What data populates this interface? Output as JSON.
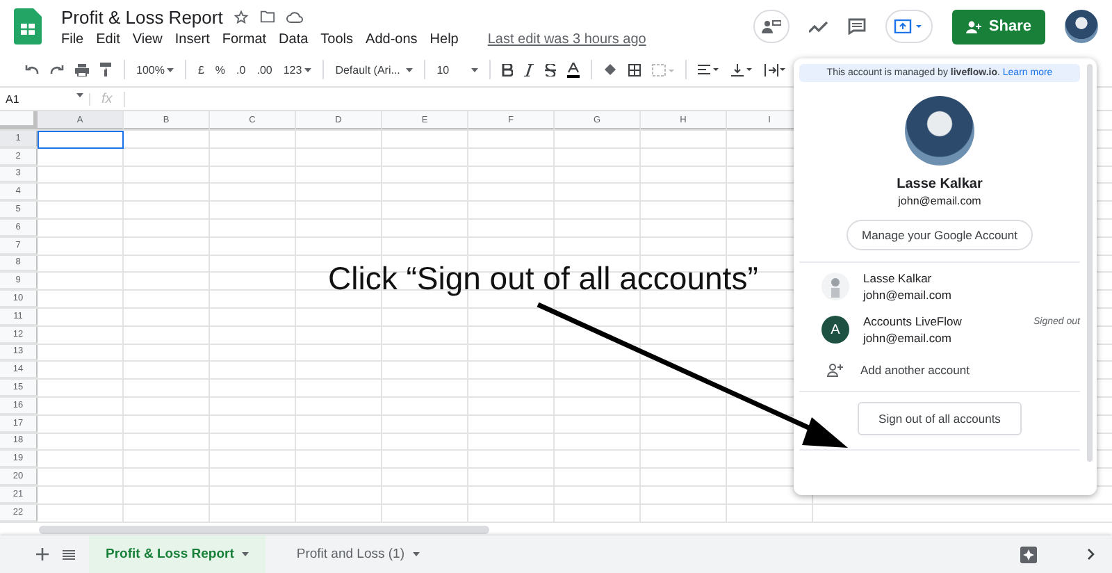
{
  "header": {
    "title": "Profit & Loss Report",
    "menu": [
      "File",
      "Edit",
      "View",
      "Insert",
      "Format",
      "Data",
      "Tools",
      "Add-ons",
      "Help"
    ],
    "last_edit": "Last edit was 3 hours ago",
    "share": "Share"
  },
  "toolbar": {
    "zoom": "100%",
    "currency": "£",
    "percent": "%",
    "decrease_decimals": ".0",
    "increase_decimals": ".00",
    "number_format": "123",
    "font": "Default (Ari...",
    "font_size": "10"
  },
  "formula_bar": {
    "name_box": "A1",
    "fx": "fx"
  },
  "grid": {
    "columns": [
      {
        "label": "A",
        "selected": true
      },
      {
        "label": "B",
        "selected": false
      },
      {
        "label": "C",
        "selected": false
      },
      {
        "label": "D",
        "selected": false
      },
      {
        "label": "E",
        "selected": false
      },
      {
        "label": "F",
        "selected": false
      },
      {
        "label": "G",
        "selected": false
      },
      {
        "label": "H",
        "selected": false
      },
      {
        "label": "I",
        "selected": false
      }
    ],
    "rows": [
      {
        "label": "1",
        "selected": true
      },
      {
        "label": "2",
        "selected": false
      },
      {
        "label": "3",
        "selected": false
      },
      {
        "label": "4",
        "selected": false
      },
      {
        "label": "5",
        "selected": false
      },
      {
        "label": "6",
        "selected": false
      },
      {
        "label": "7",
        "selected": false
      },
      {
        "label": "8",
        "selected": false
      },
      {
        "label": "9",
        "selected": false
      },
      {
        "label": "10",
        "selected": false
      },
      {
        "label": "11",
        "selected": false
      },
      {
        "label": "12",
        "selected": false
      },
      {
        "label": "13",
        "selected": false
      },
      {
        "label": "14",
        "selected": false
      },
      {
        "label": "15",
        "selected": false
      },
      {
        "label": "16",
        "selected": false
      },
      {
        "label": "17",
        "selected": false
      },
      {
        "label": "18",
        "selected": false
      },
      {
        "label": "19",
        "selected": false
      },
      {
        "label": "20",
        "selected": false
      },
      {
        "label": "21",
        "selected": false
      },
      {
        "label": "22",
        "selected": false
      }
    ]
  },
  "account_menu": {
    "banner": "This account is managed by **liveflow.io**.",
    "banner_link": "Learn more",
    "name": "Lasse Kalkar",
    "email": "john@email.com",
    "manage": "Manage your Google Account",
    "accounts": [
      {
        "kind": "photo",
        "name": "Lasse Kalkar",
        "email": "john@email.com"
      },
      {
        "kind": "letter",
        "initial": "A",
        "name": "Accounts LiveFlow",
        "email": "john@email.com",
        "status": "Signed out"
      }
    ],
    "add_account": "Add another account",
    "sign_out": "Sign out of all accounts"
  },
  "annotation": "Click “Sign out of all accounts”",
  "sheet_tabs": [
    {
      "label": "Profit & Loss Report",
      "selected": true
    },
    {
      "label": "Profit and Loss (1)",
      "selected": false
    }
  ]
}
